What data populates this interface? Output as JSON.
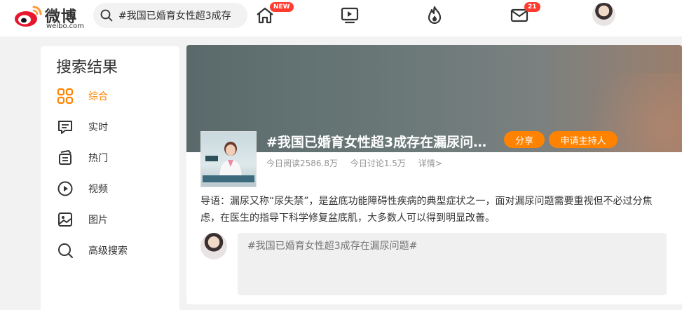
{
  "header": {
    "logo_text": "微博",
    "logo_domain": "weibo.com",
    "search_value": "#我国已婚育女性超3成存",
    "nav": {
      "home_badge": "NEW",
      "message_badge": "21"
    }
  },
  "sidebar": {
    "title": "搜索结果",
    "items": [
      {
        "label": "综合",
        "icon": "grid-icon",
        "active": true
      },
      {
        "label": "实时",
        "icon": "message-icon"
      },
      {
        "label": "热门",
        "icon": "cards-icon"
      },
      {
        "label": "视频",
        "icon": "play-icon"
      },
      {
        "label": "图片",
        "icon": "image-icon"
      },
      {
        "label": "高级搜索",
        "icon": "search-icon"
      }
    ]
  },
  "topic": {
    "title": "#我国已婚育女性超3成存在漏尿问…",
    "share_label": "分享",
    "host_label": "申请主持人",
    "read_today": "今日阅读2586.8万",
    "discuss_today": "今日讨论1.5万",
    "detail_link": "详情>",
    "lead": "导语：漏尿又称“尿失禁”，是盆底功能障碍性疾病的典型症状之一，面对漏尿问题需要重视但不必过分焦虑，在医生的指导下科学修复盆底肌，大多数人可以得到明显改善。",
    "comment_placeholder": "#我国已婚育女性超3成存在漏尿问题#"
  },
  "colors": {
    "accent": "#ff8200",
    "badge": "#ff3b30",
    "muted": "#939393"
  }
}
